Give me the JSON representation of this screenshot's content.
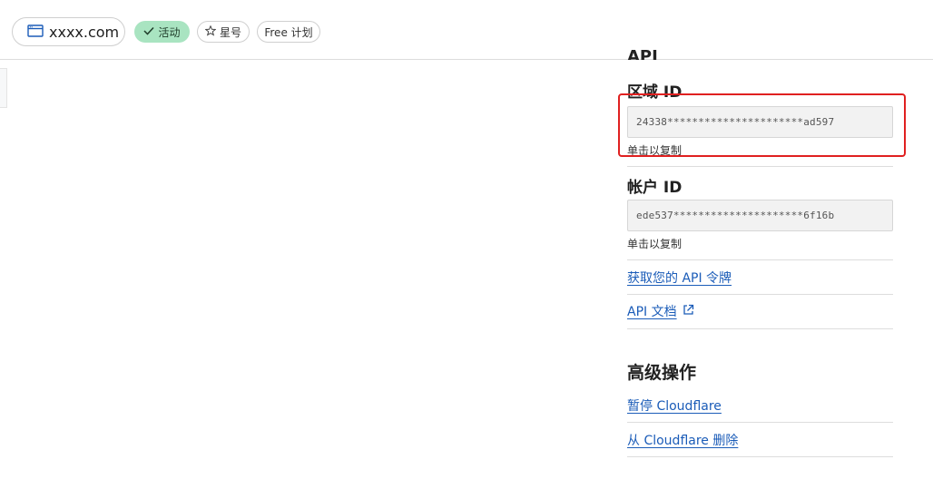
{
  "header": {
    "domain": "xxxx.com",
    "status_badge": "活动",
    "star_label": "星号",
    "plan_label": "Free 计划"
  },
  "api": {
    "heading": "API",
    "zone_title": "区域 ID",
    "zone_id": "24338**********************ad597",
    "zone_hint": "单击以复制",
    "account_title": "帐户 ID",
    "account_id": "ede537*********************6f16b",
    "account_hint": "单击以复制",
    "token_link": "获取您的 API 令牌",
    "docs_link": "API 文档"
  },
  "advanced": {
    "title": "高级操作",
    "pause_link": "暂停 Cloudflare",
    "remove_link": "从 Cloudflare 删除"
  },
  "colors": {
    "link": "#1b5cb8",
    "badge_active_bg": "#a9e4c1",
    "highlight_border": "#e02020"
  }
}
